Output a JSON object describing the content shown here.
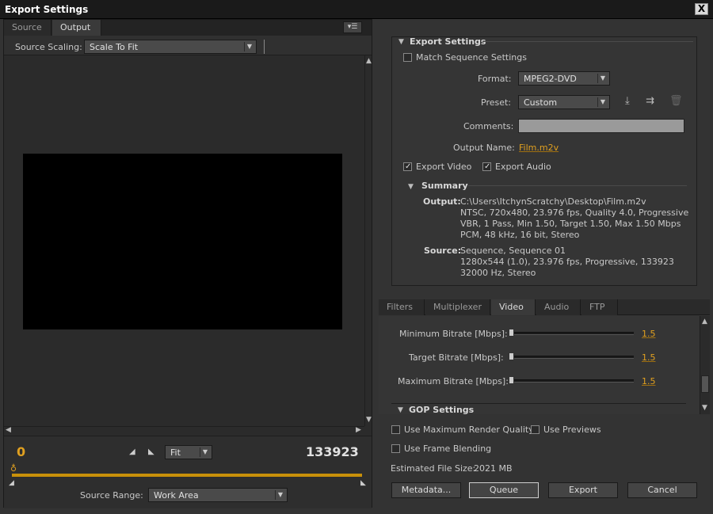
{
  "window": {
    "title": "Export Settings",
    "close_glyph": "X"
  },
  "left": {
    "tabs": [
      {
        "label": "Source"
      },
      {
        "label": "Output"
      }
    ],
    "source_scaling_label": "Source Scaling:",
    "source_scaling_value": "Scale To Fit",
    "timeline": {
      "start_frame": "0",
      "end_frame": "133923",
      "zoom_value": "Fit"
    },
    "source_range_label": "Source Range:",
    "source_range_value": "Work Area"
  },
  "export_settings": {
    "heading": "Export Settings",
    "match_sequence_label": "Match Sequence Settings",
    "match_sequence_checked": false,
    "format_label": "Format:",
    "format_value": "MPEG2-DVD",
    "preset_label": "Preset:",
    "preset_value": "Custom",
    "comments_label": "Comments:",
    "comments_value": "",
    "output_name_label": "Output Name:",
    "output_name_value": "Film.m2v",
    "export_video_label": "Export Video",
    "export_video_checked": true,
    "export_audio_label": "Export Audio",
    "export_audio_checked": true,
    "summary": {
      "heading": "Summary",
      "output_label": "Output:",
      "output_lines": [
        "C:\\Users\\ItchynScratchy\\Desktop\\Film.m2v",
        "NTSC, 720x480, 23.976 fps, Quality 4.0, Progressive",
        "VBR, 1 Pass, Min 1.50, Target 1.50, Max 1.50 Mbps",
        "PCM, 48 kHz, 16 bit, Stereo"
      ],
      "source_label": "Source:",
      "source_lines": [
        "Sequence, Sequence 01",
        "1280x544 (1.0), 23.976 fps, Progressive, 133923",
        "32000 Hz, Stereo"
      ]
    }
  },
  "settings_tabs": [
    {
      "label": "Filters"
    },
    {
      "label": "Multiplexer"
    },
    {
      "label": "Video"
    },
    {
      "label": "Audio"
    },
    {
      "label": "FTP"
    }
  ],
  "video_settings": {
    "sliders": [
      {
        "label": "Minimum Bitrate [Mbps]:",
        "value": "1.5"
      },
      {
        "label": "Target Bitrate [Mbps]:",
        "value": "1.5"
      },
      {
        "label": "Maximum Bitrate [Mbps]:",
        "value": "1.5"
      }
    ],
    "gop_heading": "GOP Settings"
  },
  "bottom": {
    "max_render_quality_label": "Use Maximum Render Quality",
    "use_previews_label": "Use Previews",
    "frame_blending_label": "Use Frame Blending",
    "estimated_size_label": "Estimated File Size:",
    "estimated_size_value": "2021 MB",
    "buttons": {
      "metadata": "Metadata...",
      "queue": "Queue",
      "export": "Export",
      "cancel": "Cancel"
    }
  }
}
